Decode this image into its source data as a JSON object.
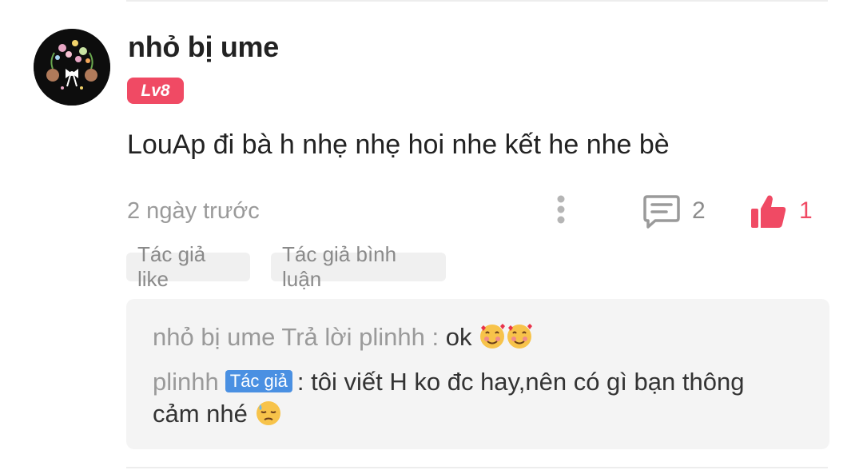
{
  "comment": {
    "username": "nhỏ bị ume",
    "level": "Lv8",
    "text": "LouAp đi bà h nhẹ nhẹ hoi nhe kết he nhe bè",
    "timestamp": "2 ngày trước",
    "reply_count": "2",
    "like_count": "1",
    "icons": {
      "more": "vertical-dots-icon",
      "reply": "comment-icon",
      "like": "thumbs-up-icon",
      "avatar": "avatar-flower-image"
    },
    "colors": {
      "accent": "#f04a64",
      "author_badge": "#4a90e2"
    },
    "tags": [
      "Tác giả like",
      "Tác giả bình luận"
    ]
  },
  "replies": [
    {
      "header": "nhỏ bị ume Trả lời plinhh :",
      "text": "ok",
      "emoji": "smiling-face-with-hearts"
    },
    {
      "author": "plinhh",
      "badge": "Tác giả",
      "separator": ":",
      "text_line1": "tôi viết H ko đc hay,nên có gì bạn thông",
      "text_line2": "cảm nhé",
      "emoji": "downcast-face-with-sweat"
    }
  ]
}
